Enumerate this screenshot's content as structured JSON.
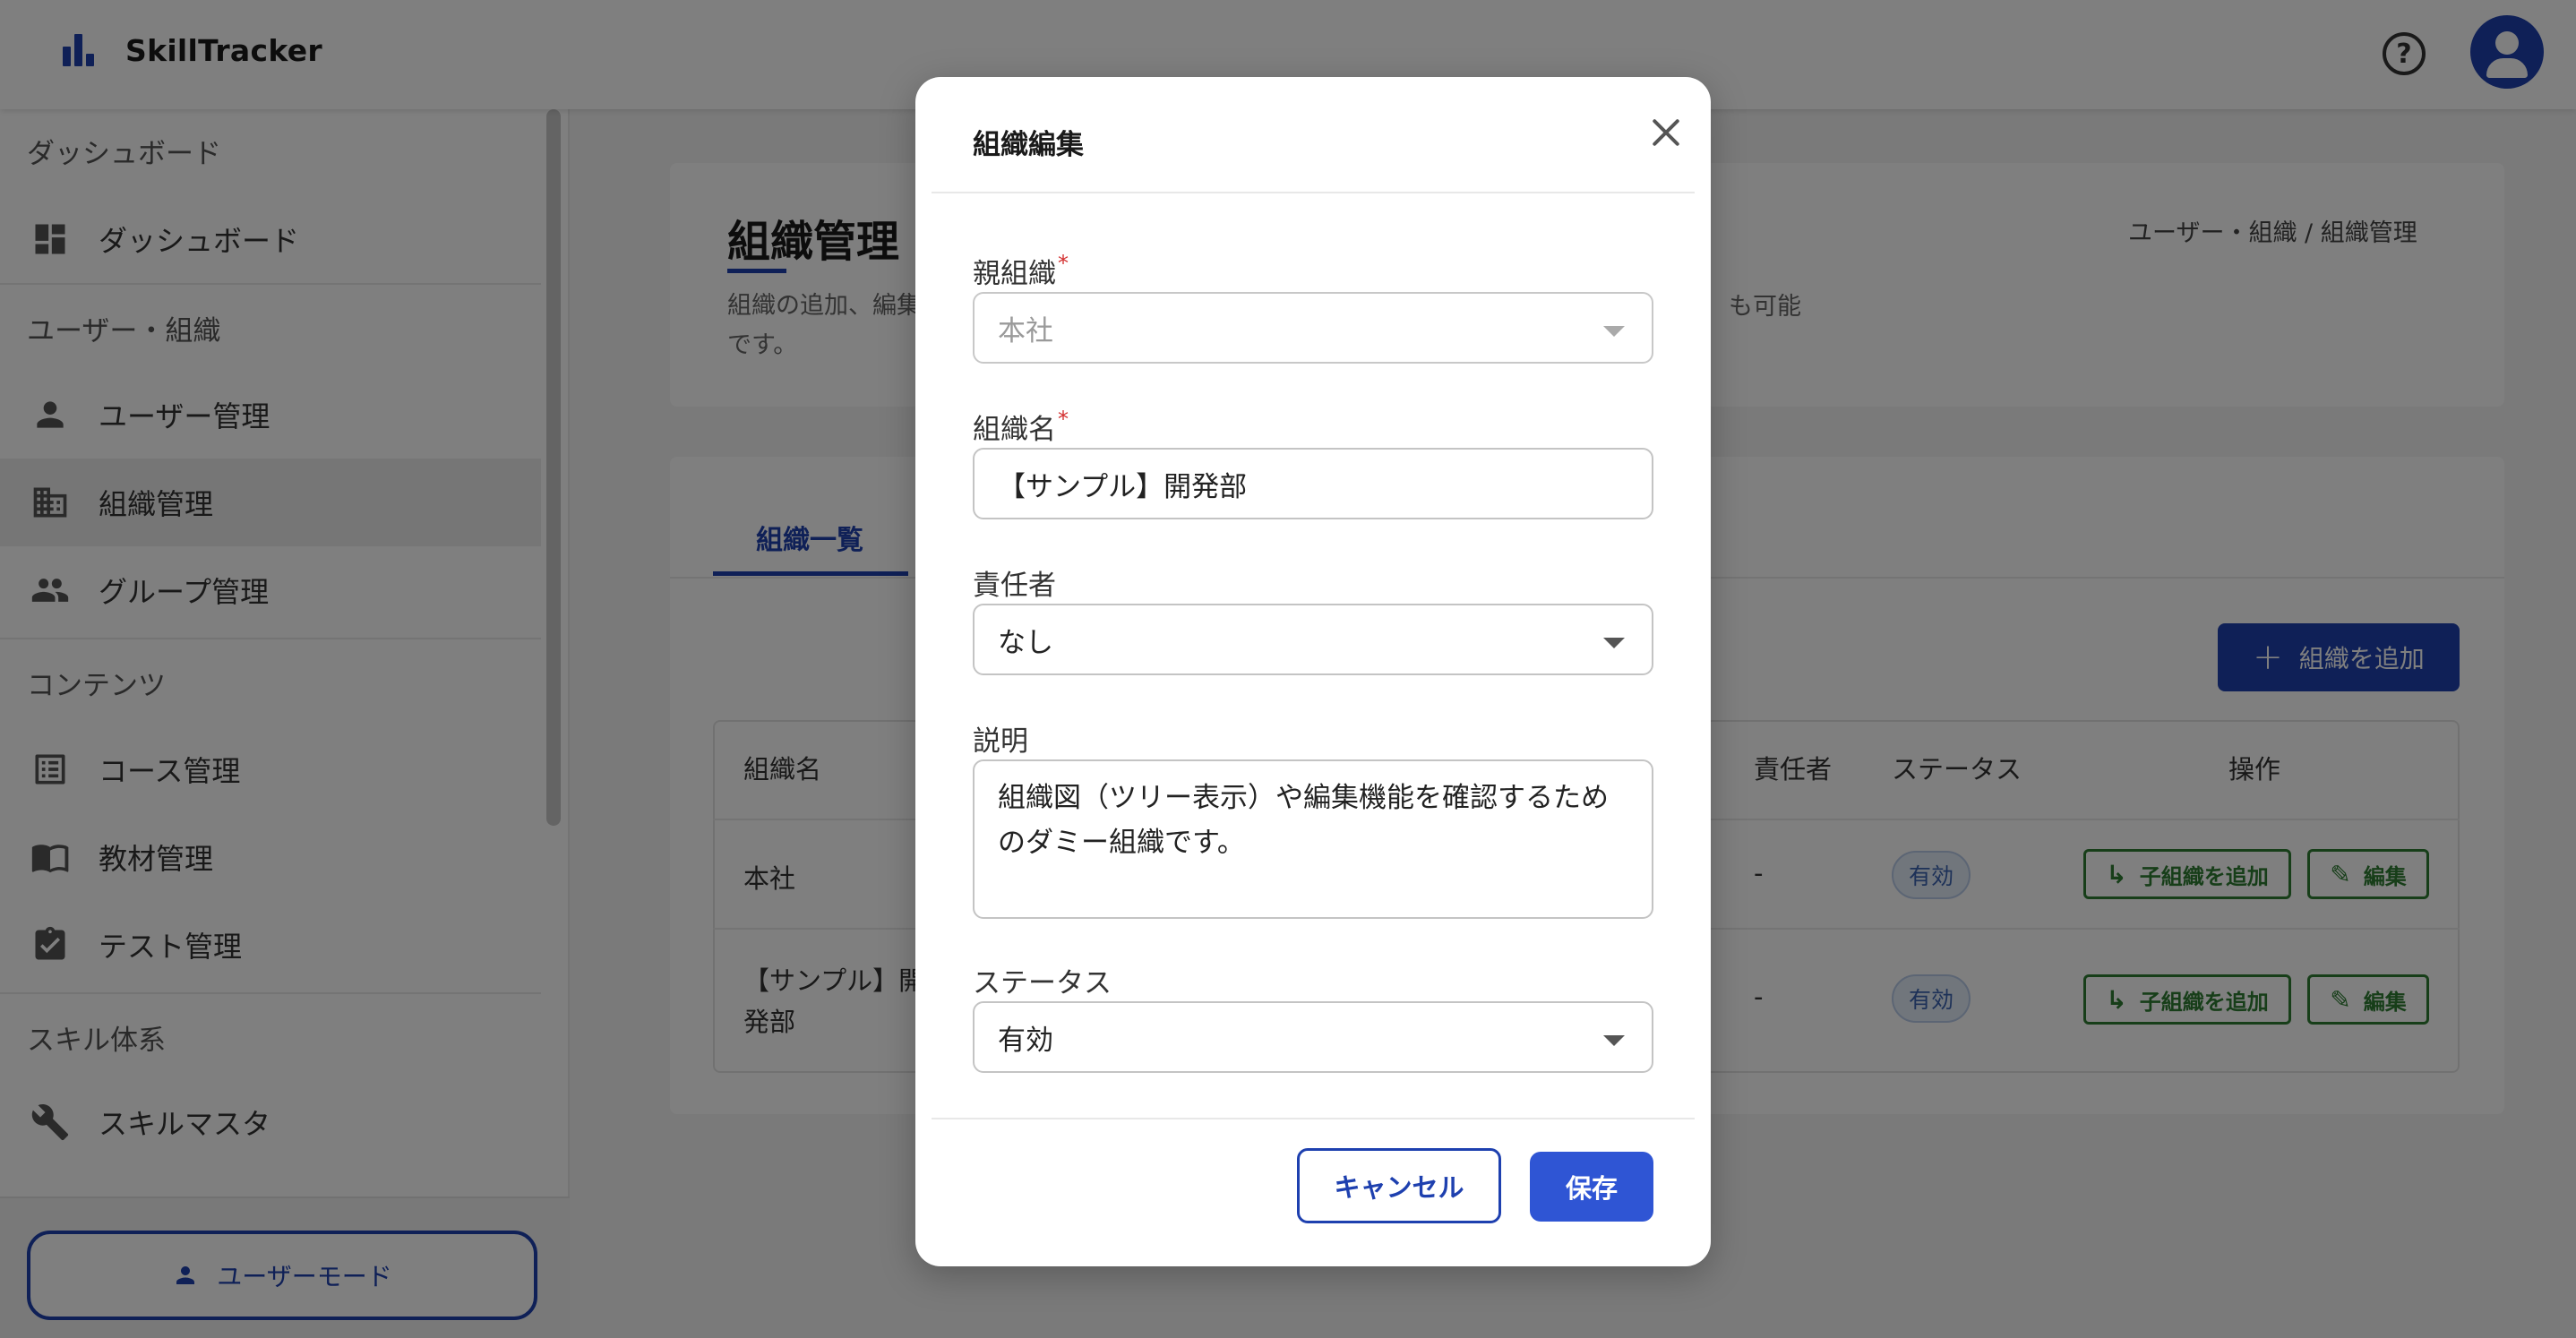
{
  "app": {
    "title": "SkillTracker"
  },
  "header": {
    "help_icon": "help-circle-icon",
    "avatar_icon": "account-icon"
  },
  "sidebar": {
    "sections": [
      {
        "label": "ダッシュボード",
        "items": [
          {
            "label": "ダッシュボード",
            "icon": "dashboard-icon",
            "active": false
          }
        ]
      },
      {
        "label": "ユーザー・組織",
        "items": [
          {
            "label": "ユーザー管理",
            "icon": "person-icon",
            "active": false
          },
          {
            "label": "組織管理",
            "icon": "building-icon",
            "active": true
          },
          {
            "label": "グループ管理",
            "icon": "group-icon",
            "active": false
          }
        ]
      },
      {
        "label": "コンテンツ",
        "items": [
          {
            "label": "コース管理",
            "icon": "list-icon",
            "active": false
          },
          {
            "label": "教材管理",
            "icon": "book-icon",
            "active": false
          },
          {
            "label": "テスト管理",
            "icon": "clipboard-check-icon",
            "active": false
          }
        ]
      },
      {
        "label": "スキル体系",
        "items": [
          {
            "label": "スキルマスタ",
            "icon": "wrench-icon",
            "active": false
          }
        ]
      }
    ],
    "user_mode_label": "ユーザーモード"
  },
  "page": {
    "title": "組織管理",
    "description_start": "組織の追加、編集",
    "description_end_line2": "です。",
    "description_tail": "も可能",
    "breadcrumb": "ユーザー・組織 / 組織管理"
  },
  "tabs": [
    {
      "label": "組織一覧",
      "active": true
    }
  ],
  "toolbar": {
    "add_org_label": "組織を追加"
  },
  "table": {
    "columns": {
      "name": "組織名",
      "manager": "責任者",
      "status": "ステータス",
      "actions": "操作"
    },
    "rows": [
      {
        "name": "本社",
        "manager": "-",
        "status": "有効"
      },
      {
        "name_line1": "【サンプル】開",
        "name_line2": "発部",
        "manager": "-",
        "status": "有効"
      }
    ],
    "add_child_label": "子組織を追加",
    "edit_label": "編集"
  },
  "modal": {
    "title": "組織編集",
    "parent_label": "親組織",
    "parent_value": "本社",
    "name_label": "組織名",
    "name_value": "【サンプル】開発部",
    "manager_label": "責任者",
    "manager_value": "なし",
    "description_label": "説明",
    "description_value": "組織図（ツリー表示）や編集機能を確認するためのダミー組織です。",
    "status_label": "ステータス",
    "status_value": "有効",
    "required_mark": "*",
    "cancel_label": "キャンセル",
    "save_label": "保存"
  },
  "colors": {
    "primary": "#1e40af",
    "success": "#2e7d32",
    "required": "#d32f2f"
  }
}
